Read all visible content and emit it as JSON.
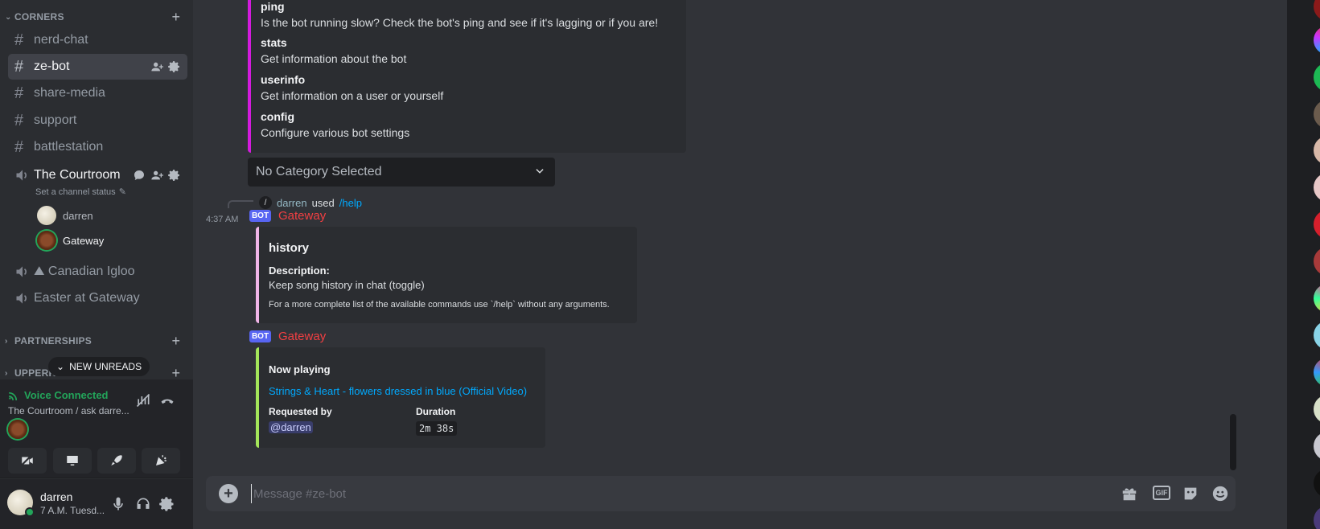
{
  "sidebar": {
    "category_corners": "CORNERS",
    "channels": [
      {
        "label": "nerd-chat"
      },
      {
        "label": "ze-bot"
      },
      {
        "label": "share-media"
      },
      {
        "label": "support"
      },
      {
        "label": "battlestation"
      }
    ],
    "voice_channel": "The Courtroom",
    "status_hint": "Set a channel status",
    "voice_users": [
      "darren",
      "Gateway"
    ],
    "voice_channel_2": "⛰ Canadian Igloo",
    "voice_channel_3": "Easter at Gateway",
    "category_partnerships": "PARTNERSHIPS",
    "category_upper": "UPPERR",
    "new_unreads": "NEW UNREADS"
  },
  "voice_panel": {
    "title": "Voice Connected",
    "subtitle": "The Courtroom / ask darre..."
  },
  "user_panel": {
    "name": "darren",
    "status": "7 A.M. Tuesd..."
  },
  "messages": {
    "help_embed": {
      "commands": [
        {
          "name": "ping",
          "desc": "Is the bot running slow? Check the bot's ping and see if it's lagging or if you are!"
        },
        {
          "name": "stats",
          "desc": "Get information about the bot"
        },
        {
          "name": "userinfo",
          "desc": "Get information on a user or yourself"
        },
        {
          "name": "config",
          "desc": "Configure various bot settings"
        }
      ],
      "color": "#d41bde"
    },
    "select_placeholder": "No Category Selected",
    "reference": {
      "user": "darren",
      "used": "used",
      "command": "/help"
    },
    "timestamp": "4:37 AM",
    "bot_tag": "BOT",
    "author": "Gateway",
    "history_embed": {
      "title": "history",
      "desc_label": "Description:",
      "desc": "Keep song history in chat (toggle)",
      "footer": "For a more complete list of the available commands use `/help` without any arguments.",
      "color": "#f0b5e8"
    },
    "nowplaying_embed": {
      "title": "Now playing",
      "link": "Strings & Heart - flowers dressed in blue (Official Video)",
      "requested_label": "Requested by",
      "requested_value": "@darren",
      "duration_label": "Duration",
      "duration_value": "2m 38s",
      "color": "#a4e65a"
    }
  },
  "composer": {
    "placeholder": "Message #ze-bot",
    "gif_label": "GIF"
  }
}
